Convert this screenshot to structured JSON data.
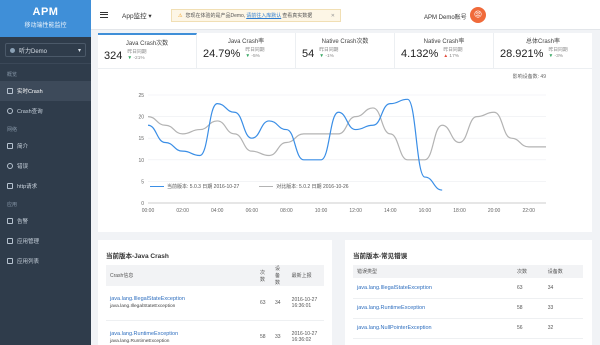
{
  "brand": {
    "title": "APM",
    "subtitle": "移动端性能监控"
  },
  "app_selector": {
    "value": "听力Demo"
  },
  "sidebar": {
    "sections": [
      {
        "label": "概览",
        "items": [
          {
            "label": "实时Crash",
            "active": true
          },
          {
            "label": "Crash查询"
          }
        ]
      },
      {
        "label": "网络",
        "items": [
          {
            "label": "简介"
          },
          {
            "label": "错误"
          },
          {
            "label": "http请求"
          }
        ]
      },
      {
        "label": "应用",
        "items": [
          {
            "label": "告警"
          },
          {
            "label": "应用管理"
          },
          {
            "label": "应用列表"
          }
        ]
      }
    ]
  },
  "topbar": {
    "app_monitor": "App监控",
    "alert_text_1": "您现在体验的是产品Demo,",
    "alert_link": "请前往入库默认",
    "alert_text_2": "查看真实数据",
    "account": "APM Demo账号",
    "avatar": "😡"
  },
  "kpis": [
    {
      "label": "Java Crash次数",
      "value": "324",
      "cmp_label": "昨日同期",
      "cmp_value": "-21%",
      "dir": "down",
      "active": true
    },
    {
      "label": "Java Crash率",
      "value": "24.79%",
      "cmp_label": "昨日同期",
      "cmp_value": "-5%",
      "dir": "down"
    },
    {
      "label": "Native Crash次数",
      "value": "54",
      "cmp_label": "昨日同期",
      "cmp_value": "-1%",
      "dir": "down"
    },
    {
      "label": "Native Crash率",
      "value": "4.132%",
      "cmp_label": "昨日同期",
      "cmp_value": "17%",
      "dir": "up"
    },
    {
      "label": "总体Crash率",
      "value": "28.921%",
      "cmp_label": "昨日同期",
      "cmp_value": "-3%",
      "dir": "down"
    }
  ],
  "device_count": "影响设备数: 49",
  "chart_data": {
    "type": "line",
    "x": [
      "00:00",
      "01:00",
      "02:00",
      "03:00",
      "04:00",
      "05:00",
      "06:00",
      "07:00",
      "08:00",
      "09:00",
      "10:00",
      "11:00",
      "12:00",
      "13:00",
      "14:00",
      "15:00",
      "16:00",
      "17:00",
      "18:00",
      "19:00",
      "20:00",
      "21:00",
      "22:00",
      "23:00"
    ],
    "ylim": [
      0,
      25
    ],
    "yticks": [
      0,
      5,
      10,
      15,
      20,
      25
    ],
    "xticks": [
      "00:00",
      "02:00",
      "04:00",
      "06:00",
      "08:00",
      "10:00",
      "12:00",
      "14:00",
      "16:00",
      "18:00",
      "20:00",
      "22:00"
    ],
    "series": [
      {
        "name": "当前版本: 5.0.3 日期 2016-10-27",
        "color": "#3a8ee6",
        "values": [
          18,
          14,
          12,
          11,
          23,
          21,
          15,
          19,
          17,
          10,
          10,
          21,
          17,
          18,
          23,
          24,
          6,
          3,
          null,
          null,
          null,
          null,
          null,
          null
        ]
      },
      {
        "name": "对比版本: 5.0.2 日期 2016-10-26",
        "color": "#b3b3b3",
        "values": [
          20,
          18,
          16,
          17,
          19,
          16,
          12,
          11,
          14,
          16,
          16,
          16,
          20,
          22,
          16,
          10,
          10,
          18,
          14,
          20,
          21,
          15,
          13,
          13
        ]
      }
    ]
  },
  "left_card": {
    "title": "当前版本-Java Crash",
    "headers": [
      "Crash信息",
      "次数",
      "设备数",
      "最新上报"
    ],
    "rows": [
      {
        "name": "java.lang.IllegalStateException",
        "detail": "java.lang.IllegalStateException",
        "count": "63",
        "devices": "34",
        "time": "2016-10-27 16:36:01"
      },
      {
        "name": "java.lang.RuntimeException",
        "detail": "java.lang.RuntimeException",
        "count": "58",
        "devices": "33",
        "time": "2016-10-27 16:36:02"
      }
    ]
  },
  "right_card": {
    "title": "当前版本-常见错误",
    "headers": [
      "错误类型",
      "次数",
      "设备数"
    ],
    "rows": [
      {
        "name": "java.lang.IllegalStateException",
        "count": "63",
        "devices": "34"
      },
      {
        "name": "java.lang.RuntimeException",
        "count": "58",
        "devices": "33"
      },
      {
        "name": "java.lang.NullPointerException",
        "count": "56",
        "devices": "32"
      }
    ]
  }
}
